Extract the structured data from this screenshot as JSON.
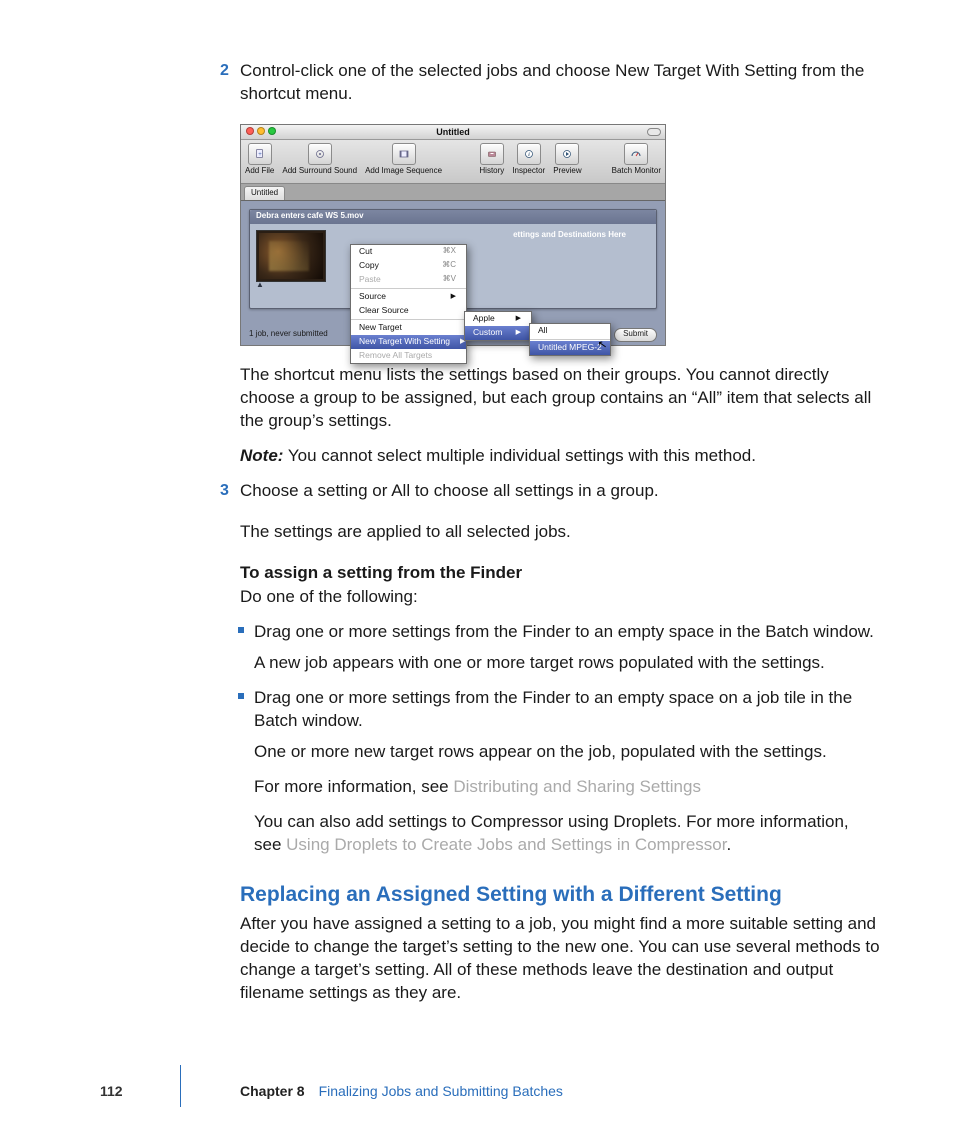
{
  "step2": {
    "num": "2",
    "text": "Control-click one of the selected jobs and choose New Target With Setting from the shortcut menu."
  },
  "shot": {
    "window_title": "Untitled",
    "toolbar_left": [
      {
        "label": "Add File"
      },
      {
        "label": "Add Surround Sound"
      },
      {
        "label": "Add Image Sequence"
      }
    ],
    "toolbar_right": [
      {
        "label": "History"
      },
      {
        "label": "Inspector"
      },
      {
        "label": "Preview"
      }
    ],
    "toolbar_far": {
      "label": "Batch Monitor"
    },
    "tab": "Untitled",
    "job_clip": "Debra enters cafe WS 5.mov",
    "drop_hint": "ettings and Destinations Here",
    "status": "1 job, never submitted",
    "submit": "Submit",
    "menu1": {
      "cut": {
        "label": "Cut",
        "shortcut": "⌘X"
      },
      "copy": {
        "label": "Copy",
        "shortcut": "⌘C"
      },
      "paste": {
        "label": "Paste",
        "shortcut": "⌘V"
      },
      "source": {
        "label": "Source"
      },
      "clear_source": {
        "label": "Clear Source"
      },
      "new_target": {
        "label": "New Target"
      },
      "new_target_with_setting": {
        "label": "New Target With Setting"
      },
      "remove_all": {
        "label": "Remove All Targets"
      }
    },
    "menu2": {
      "apple": {
        "label": "Apple"
      },
      "custom": {
        "label": "Custom"
      }
    },
    "menu3": {
      "all": {
        "label": "All"
      },
      "item": {
        "label": "Untitled MPEG-2"
      }
    }
  },
  "after_shot_p": "The shortcut menu lists the settings based on their groups. You cannot directly choose a group to be assigned, but each group contains an “All” item that selects all the group’s settings.",
  "note_label": "Note:",
  "note_text": "  You cannot select multiple individual settings with this method.",
  "step3": {
    "num": "3",
    "text": "Choose a setting or All to choose all settings in a group.",
    "follow": "The settings are applied to all selected jobs."
  },
  "finder_heading": "To assign a setting from the Finder",
  "finder_sub": "Do one of the following:",
  "bullets": [
    {
      "main": "Drag one or more settings from the Finder to an empty space in the Batch window.",
      "follow": "A new job appears with one or more target rows populated with the settings."
    },
    {
      "main": "Drag one or more settings from the Finder to an empty space on a job tile in the Batch window.",
      "follow": "One or more new target rows appear on the job, populated with the settings."
    }
  ],
  "for_more_1a": "For more information, see ",
  "for_more_1b": "Distributing and Sharing Settings",
  "for_more_2a": "You can also add settings to Compressor using Droplets. For more information, see ",
  "for_more_2b": "Using Droplets to Create Jobs and Settings in Compressor",
  "for_more_2c": ".",
  "section_heading": "Replacing an Assigned Setting with a Different Setting",
  "section_body": "After you have assigned a setting to a job, you might find a more suitable setting and decide to change the target’s setting to the new one. You can use several methods to change a target’s setting. All of these methods leave the destination and output filename settings as they are.",
  "footer": {
    "page": "112",
    "chapter": "Chapter 8",
    "title": "Finalizing Jobs and Submitting Batches"
  }
}
